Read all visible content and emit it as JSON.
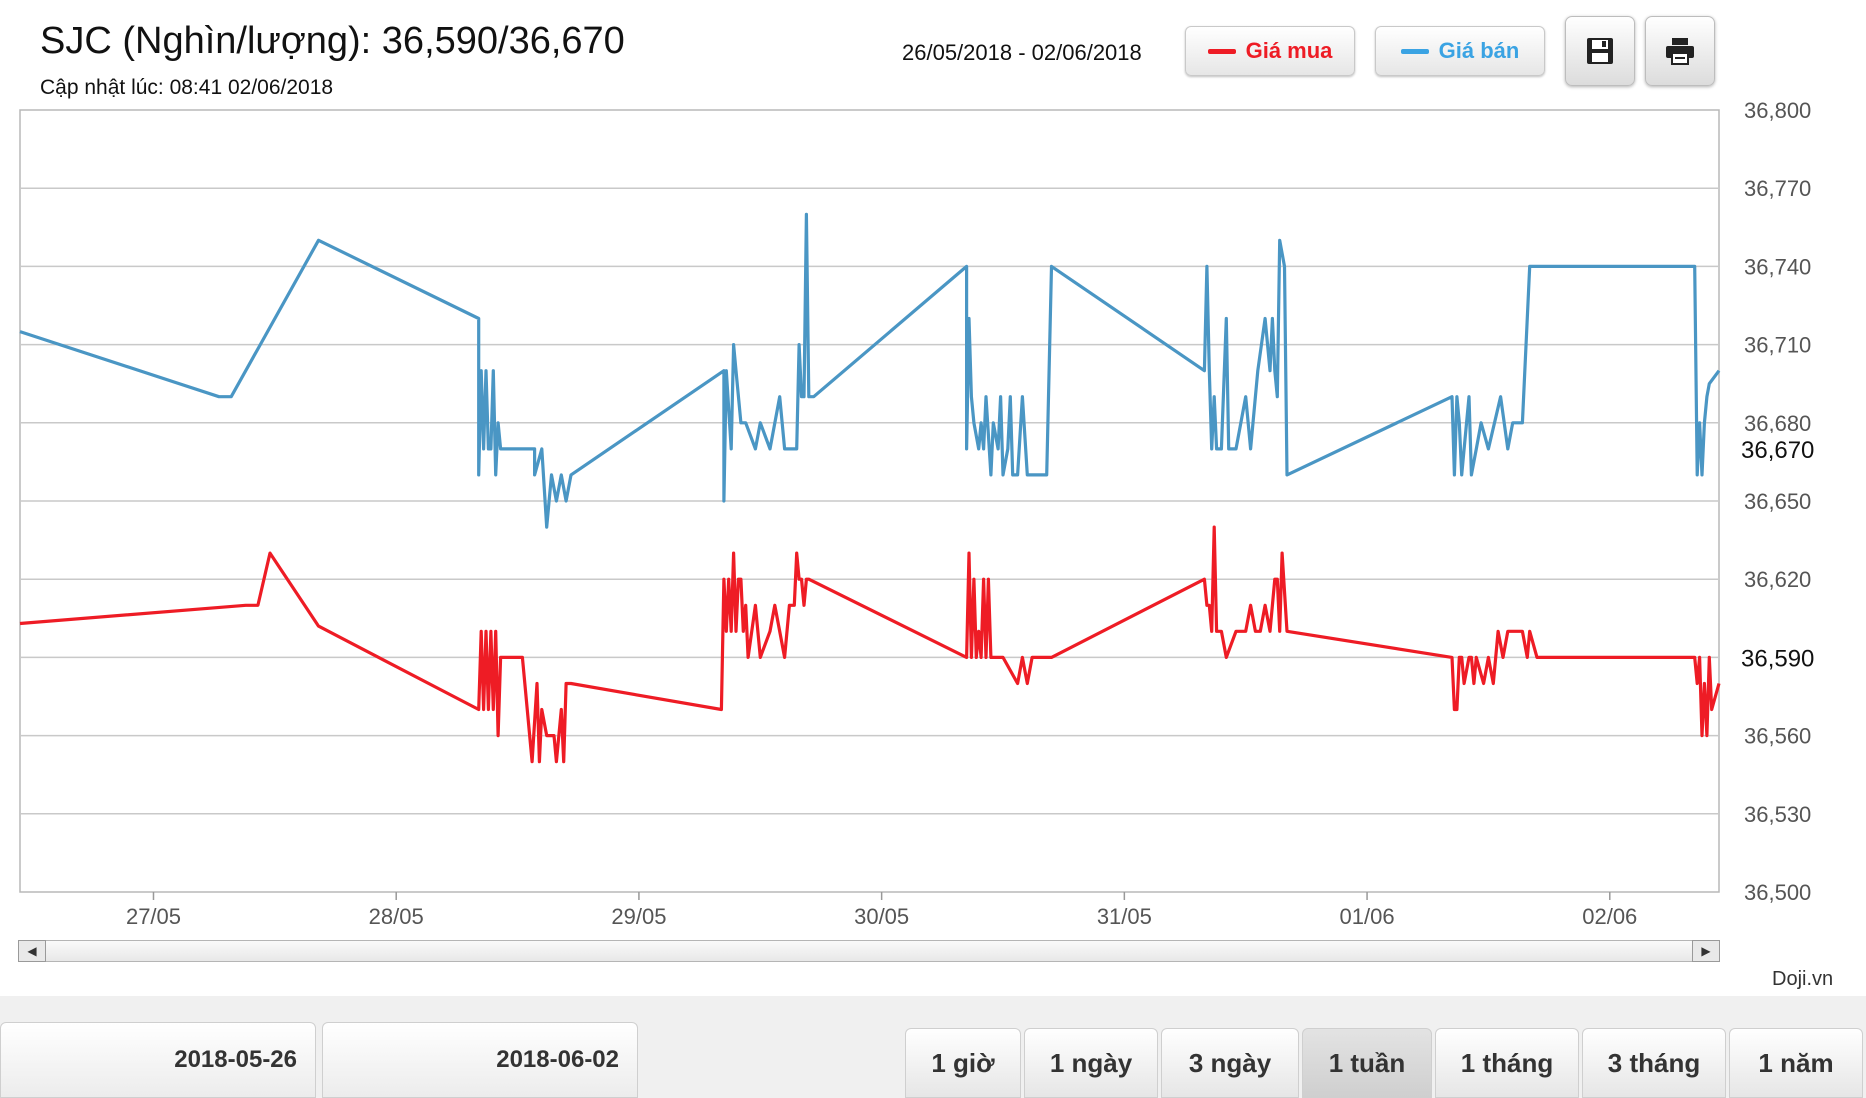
{
  "header": {
    "title": "SJC (Nghìn/lượng): 36,590/36,670",
    "updated": "Cập nhật lúc: 08:41 02/06/2018",
    "range": "26/05/2018 - 02/06/2018",
    "legend_buy": "Giá mua",
    "legend_sell": "Giá bán",
    "save_icon": "floppy-disk-icon",
    "print_icon": "printer-icon"
  },
  "colors": {
    "buy": "#ee1c25",
    "sell": "#4a96c4",
    "grid": "#c9c9c9"
  },
  "credit": "Doji.vn",
  "footer": {
    "date_from": "2018-05-26",
    "date_to": "2018-06-02",
    "periods": [
      "1 giờ",
      "1 ngày",
      "3 ngày",
      "1 tuần",
      "1 tháng",
      "3 tháng",
      "1 năm"
    ],
    "active_period": "1 tuần"
  },
  "chart_data": {
    "type": "line",
    "ylim": [
      36500,
      36800
    ],
    "xlim": [
      26.45,
      33.45
    ],
    "yticks": [
      "36,800",
      "36,770",
      "36,740",
      "36,710",
      "36,680",
      "36,650",
      "36,620",
      "36,590",
      "36,560",
      "36,530",
      "36,500"
    ],
    "xticks": [
      {
        "label": "27/05",
        "x": 27
      },
      {
        "label": "28/05",
        "x": 28
      },
      {
        "label": "29/05",
        "x": 29
      },
      {
        "label": "30/05",
        "x": 30
      },
      {
        "label": "31/05",
        "x": 31
      },
      {
        "label": "01/06",
        "x": 32
      },
      {
        "label": "02/06",
        "x": 33
      }
    ],
    "current_labels": [
      "36,670",
      "36,590"
    ],
    "series": [
      {
        "name": "Giá bán",
        "x": [
          26.45,
          27.27,
          27.32,
          27.44,
          27.68,
          28.34,
          28.34,
          28.35,
          28.36,
          28.37,
          28.38,
          28.39,
          28.4,
          28.41,
          28.42,
          28.43,
          28.44,
          28.46,
          28.57,
          28.57,
          28.6,
          28.62,
          28.64,
          28.66,
          28.68,
          28.7,
          28.72,
          29.35,
          29.35,
          29.36,
          29.38,
          29.39,
          29.4,
          29.42,
          29.44,
          29.48,
          29.5,
          29.54,
          29.58,
          29.6,
          29.63,
          29.65,
          29.66,
          29.67,
          29.68,
          29.69,
          29.7,
          29.7,
          29.72,
          30.35,
          30.35,
          30.36,
          30.37,
          30.38,
          30.4,
          30.41,
          30.42,
          30.43,
          30.45,
          30.46,
          30.48,
          30.49,
          30.5,
          30.52,
          30.53,
          30.54,
          30.56,
          30.58,
          30.6,
          30.61,
          30.62,
          30.68,
          30.7,
          31.33,
          31.34,
          31.35,
          31.36,
          31.37,
          31.38,
          31.4,
          31.42,
          31.43,
          31.44,
          31.46,
          31.5,
          31.52,
          31.54,
          31.55,
          31.58,
          31.6,
          31.61,
          31.62,
          31.63,
          31.64,
          31.66,
          31.67,
          32.35,
          32.36,
          32.37,
          32.38,
          32.39,
          32.42,
          32.43,
          32.45,
          32.47,
          32.5,
          32.55,
          32.58,
          32.6,
          32.64,
          32.67,
          32.7,
          33.35,
          33.36,
          33.37,
          33.38,
          33.39,
          33.4,
          33.41,
          33.45
        ],
        "values": [
          36715,
          36690,
          36690,
          36710,
          36750,
          36720,
          36660,
          36700,
          36670,
          36700,
          36670,
          36670,
          36700,
          36660,
          36680,
          36670,
          36670,
          36670,
          36670,
          36660,
          36670,
          36640,
          36660,
          36650,
          36660,
          36650,
          36660,
          36700,
          36650,
          36700,
          36670,
          36710,
          36700,
          36680,
          36680,
          36670,
          36680,
          36670,
          36690,
          36670,
          36670,
          36670,
          36710,
          36690,
          36690,
          36760,
          36690,
          36690,
          36690,
          36740,
          36670,
          36720,
          36690,
          36680,
          36670,
          36680,
          36670,
          36690,
          36660,
          36680,
          36670,
          36690,
          36660,
          36670,
          36690,
          36660,
          36660,
          36690,
          36660,
          36660,
          36660,
          36660,
          36740,
          36700,
          36740,
          36700,
          36670,
          36690,
          36670,
          36670,
          36720,
          36670,
          36670,
          36670,
          36690,
          36670,
          36690,
          36700,
          36720,
          36700,
          36720,
          36700,
          36690,
          36750,
          36740,
          36660,
          36690,
          36660,
          36690,
          36680,
          36660,
          36690,
          36660,
          36670,
          36680,
          36670,
          36690,
          36670,
          36680,
          36680,
          36740,
          36740,
          36740,
          36660,
          36680,
          36660,
          36680,
          36690,
          36695,
          36700
        ]
      },
      {
        "name": "Giá mua",
        "x": [
          26.45,
          27.38,
          27.43,
          27.48,
          27.68,
          28.34,
          28.35,
          28.36,
          28.37,
          28.38,
          28.39,
          28.4,
          28.41,
          28.42,
          28.43,
          28.44,
          28.45,
          28.46,
          28.47,
          28.52,
          28.56,
          28.58,
          28.59,
          28.6,
          28.62,
          28.65,
          28.66,
          28.68,
          28.69,
          28.7,
          28.71,
          28.72,
          29.34,
          29.35,
          29.36,
          29.37,
          29.38,
          29.39,
          29.4,
          29.41,
          29.42,
          29.43,
          29.44,
          29.45,
          29.48,
          29.5,
          29.54,
          29.56,
          29.58,
          29.6,
          29.62,
          29.64,
          29.65,
          29.66,
          29.67,
          29.68,
          29.69,
          29.7,
          30.35,
          30.36,
          30.37,
          30.38,
          30.39,
          30.4,
          30.41,
          30.42,
          30.43,
          30.44,
          30.45,
          30.46,
          30.48,
          30.5,
          30.56,
          30.58,
          30.6,
          30.62,
          30.68,
          30.7,
          31.33,
          31.34,
          31.35,
          31.36,
          31.37,
          31.38,
          31.4,
          31.42,
          31.46,
          31.5,
          31.52,
          31.54,
          31.56,
          31.58,
          31.6,
          31.62,
          31.63,
          31.64,
          31.65,
          31.67,
          32.35,
          32.36,
          32.37,
          32.38,
          32.39,
          32.4,
          32.42,
          32.43,
          32.44,
          32.45,
          32.48,
          32.5,
          32.52,
          32.54,
          32.56,
          32.58,
          32.6,
          32.62,
          32.64,
          32.66,
          32.67,
          32.7,
          33.35,
          33.36,
          33.37,
          33.38,
          33.39,
          33.4,
          33.41,
          33.42,
          33.45
        ],
        "values": [
          36603,
          36610,
          36610,
          36630,
          36602,
          36570,
          36600,
          36570,
          36600,
          36570,
          36600,
          36570,
          36600,
          36560,
          36590,
          36590,
          36590,
          36590,
          36590,
          36590,
          36550,
          36580,
          36550,
          36570,
          36560,
          36560,
          36550,
          36570,
          36550,
          36580,
          36580,
          36580,
          36570,
          36620,
          36600,
          36620,
          36600,
          36630,
          36600,
          36620,
          36620,
          36600,
          36610,
          36590,
          36610,
          36590,
          36600,
          36610,
          36600,
          36590,
          36610,
          36610,
          36630,
          36620,
          36620,
          36610,
          36620,
          36620,
          36590,
          36630,
          36590,
          36620,
          36590,
          36600,
          36590,
          36620,
          36590,
          36620,
          36590,
          36590,
          36590,
          36590,
          36580,
          36590,
          36580,
          36590,
          36590,
          36590,
          36620,
          36610,
          36610,
          36600,
          36640,
          36600,
          36600,
          36590,
          36600,
          36600,
          36610,
          36600,
          36600,
          36610,
          36600,
          36620,
          36620,
          36600,
          36630,
          36600,
          36590,
          36570,
          36570,
          36590,
          36590,
          36580,
          36590,
          36590,
          36580,
          36590,
          36580,
          36590,
          36580,
          36600,
          36590,
          36600,
          36600,
          36600,
          36600,
          36590,
          36600,
          36590,
          36590,
          36580,
          36590,
          36560,
          36580,
          36560,
          36590,
          36570,
          36580
        ]
      }
    ]
  }
}
